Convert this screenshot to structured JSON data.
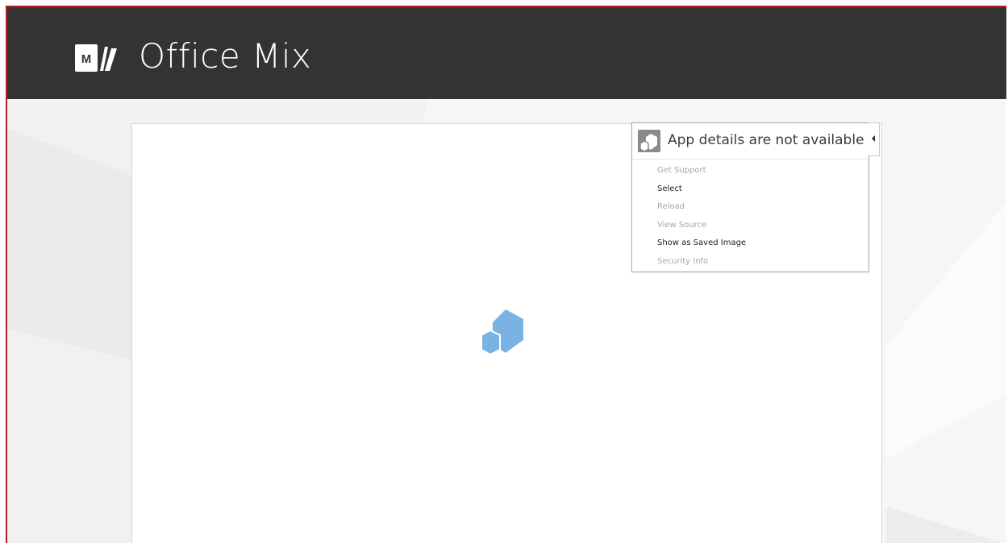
{
  "header": {
    "logo_letter": "M",
    "title": "Office Mix"
  },
  "app_panel": {
    "loading_icon": "app-cubes-icon",
    "menu": {
      "title": "App details are not available",
      "icon": "app-cube-icon",
      "items": [
        {
          "label": "Get Support",
          "enabled": false
        },
        {
          "label": "Select",
          "enabled": true
        },
        {
          "label": "Reload",
          "enabled": false
        },
        {
          "label": "View Source",
          "enabled": false
        },
        {
          "label": "Show as Saved Image",
          "enabled": true
        },
        {
          "label": "Security Info",
          "enabled": false
        }
      ]
    },
    "collapse_icon": "triangle-left-icon"
  },
  "colors": {
    "header_bg": "#333333",
    "frame_border": "#b02020",
    "cube_blue": "#7ab3e3"
  }
}
